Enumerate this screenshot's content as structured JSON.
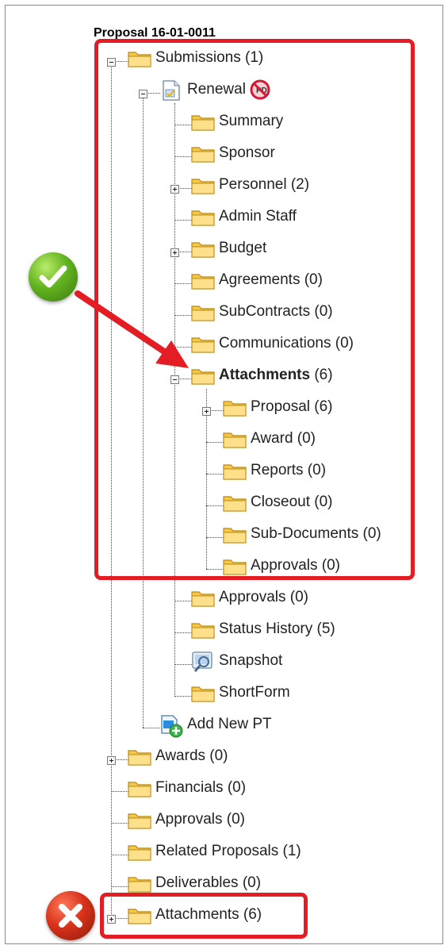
{
  "tree": {
    "title": "Proposal 16-01-0011",
    "submissions": "Submissions (1)",
    "renewal": "Renewal",
    "summary": "Summary",
    "sponsor": "Sponsor",
    "personnel": "Personnel (2)",
    "admin_staff": "Admin Staff",
    "budget": "Budget",
    "agreements": "Agreements (0)",
    "subcontracts": "SubContracts (0)",
    "communications": "Communications (0)",
    "attachments_bold": "Attachments",
    "attachments_count": " (6)",
    "att_proposal": "Proposal (6)",
    "att_award": "Award (0)",
    "att_reports": "Reports (0)",
    "att_closeout": "Closeout (0)",
    "att_subdocs": "Sub-Documents (0)",
    "att_approvals": "Approvals (0)",
    "approvals": "Approvals (0)",
    "status_history": "Status History (5)",
    "snapshot": "Snapshot",
    "shortform": "ShortForm",
    "add_new_pt": "Add New PT",
    "awards": "Awards (0)",
    "financials": "Financials (0)",
    "root_approvals": "Approvals (0)",
    "related_proposals": "Related Proposals (1)",
    "deliverables": "Deliverables (0)",
    "root_attachments": "Attachments (6)"
  },
  "colors": {
    "highlight": "#e41c23",
    "correct": "#62b320",
    "wrong": "#d8321a",
    "folder": "#f5c84a"
  },
  "icons": {
    "folder": "folder-icon",
    "document": "document-icon",
    "no_entry": "no-entry-icon",
    "snapshot": "snapshot-icon",
    "add": "add-page-icon",
    "check": "check-icon",
    "cross": "cross-icon",
    "arrow": "arrow-icon"
  }
}
